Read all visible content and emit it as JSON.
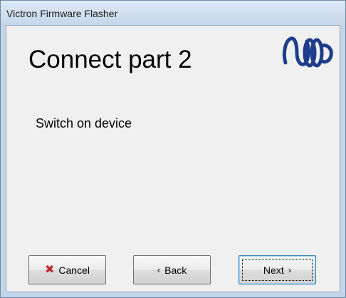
{
  "window": {
    "title": "Victron Firmware Flasher"
  },
  "page": {
    "title": "Connect part 2",
    "instruction": "Switch on device"
  },
  "logo": {
    "icon": "victron-logo-icon",
    "color": "#1f3d8c"
  },
  "buttons": {
    "cancel": {
      "label": "Cancel",
      "icon": "red-x-icon",
      "icon_color": "#c0282d"
    },
    "back": {
      "label": "Back",
      "icon": "chevron-left-icon"
    },
    "next": {
      "label": "Next",
      "icon": "chevron-right-icon"
    }
  }
}
